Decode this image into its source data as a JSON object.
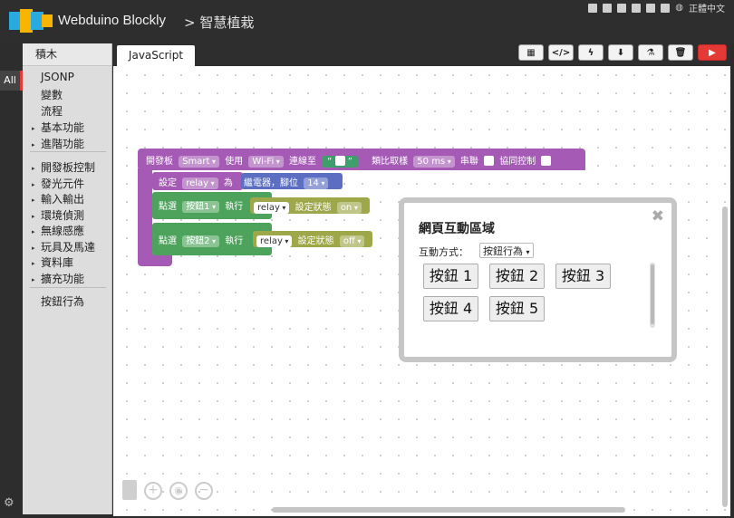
{
  "header": {
    "app_title": "Webduino Blockly",
    "breadcrumb": "> 智慧植栽",
    "language": "正體中文"
  },
  "sidebar": {
    "all_tab": "All",
    "toolbox_title": "積木",
    "items": [
      {
        "label": "JSONP",
        "arrow": false
      },
      {
        "label": "變數",
        "arrow": false
      },
      {
        "label": "流程",
        "arrow": false
      },
      {
        "label": "基本功能",
        "arrow": true
      },
      {
        "label": "進階功能",
        "arrow": true
      },
      {
        "label": "開發板控制",
        "arrow": true
      },
      {
        "label": "發光元件",
        "arrow": true
      },
      {
        "label": "輸入輸出",
        "arrow": true
      },
      {
        "label": "環境偵測",
        "arrow": true
      },
      {
        "label": "無線感應",
        "arrow": true
      },
      {
        "label": "玩具及馬達",
        "arrow": true
      },
      {
        "label": "資料庫",
        "arrow": true
      },
      {
        "label": "擴充功能",
        "arrow": true
      },
      {
        "label": "按鈕行為",
        "arrow": false
      }
    ]
  },
  "editor": {
    "tab_label": "JavaScript",
    "toolbar": [
      "qr-icon",
      "code-icon",
      "flash-icon",
      "download-icon",
      "flask-icon",
      "trash-icon",
      "run-icon"
    ]
  },
  "blocks": {
    "board": {
      "label": "開發板",
      "type": "Smart",
      "use_label": "使用",
      "conn": "Wi-Fi",
      "connect_to": "連線至",
      "quote_open": "“",
      "quote_close": "”",
      "sampling_label": "類比取樣",
      "sampling": "50 ms",
      "serial_label": "串聯",
      "coop_label": "協同控制"
    },
    "set": {
      "label": "設定",
      "var": "relay",
      "as": "為",
      "device": "繼電器，腳位",
      "pin": "14"
    },
    "click1": {
      "label": "點選",
      "button": "按鈕1",
      "exec": "執行",
      "target": "relay",
      "action": "設定狀態",
      "state": "on"
    },
    "click2": {
      "label": "點選",
      "button": "按鈕2",
      "exec": "執行",
      "target": "relay",
      "action": "設定狀態",
      "state": "off"
    }
  },
  "panel": {
    "title": "網頁互動區域",
    "close": "✖",
    "mode_label": "互動方式：",
    "mode_value": "按鈕行為",
    "buttons": [
      "按鈕 1",
      "按鈕 2",
      "按鈕 3",
      "按鈕 4",
      "按鈕 5"
    ]
  },
  "workspace_controls": {
    "zoom_in": "+",
    "center": "◉",
    "zoom_out": "−"
  }
}
